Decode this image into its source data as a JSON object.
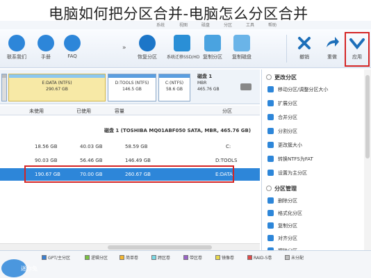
{
  "title": "电脑如何把分区合并-电脑怎么分区合并",
  "menubar": {
    "items": [
      "系统",
      "视图",
      "磁盘",
      "分区",
      "工具",
      "帮助"
    ]
  },
  "toolbar": {
    "items": [
      {
        "label": "恢复分区",
        "icon": "recover-icon",
        "color": "#1c76c8"
      },
      {
        "label": "系统迁移SSD/HD",
        "icon": "migrate-icon",
        "color": "#2a8fd6"
      },
      {
        "label": "复制分区",
        "icon": "copy-partition-icon",
        "color": "#4aa3e0"
      },
      {
        "label": "复制磁盘",
        "icon": "copy-disk-icon",
        "color": "#6ab4e8"
      },
      {
        "label": "撤销",
        "icon": "undo-icon",
        "color": "#1d6fb9"
      },
      {
        "label": "重做",
        "icon": "redo-icon",
        "color": "#1d6fb9"
      },
      {
        "label": "应用",
        "icon": "apply-icon",
        "color": "#1d6fb9"
      }
    ],
    "left_items": [
      {
        "label": "联系我们",
        "icon": "email-icon",
        "color": "#2d86d9"
      },
      {
        "label": "手册",
        "icon": "help-icon",
        "color": "#2d86d9"
      },
      {
        "label": "FAQ",
        "icon": "faq-icon",
        "color": "#2d86d9"
      }
    ],
    "more": "»"
  },
  "disk_map": {
    "partitions": [
      {
        "label": "未分配",
        "size": "",
        "selected": false
      },
      {
        "label": "E:DATA (NTFS)",
        "size": "290.67 GB",
        "selected": true
      },
      {
        "label": "D:TOOLS (NTFS)",
        "size": "146.5 GB",
        "selected": false
      },
      {
        "label": "C:(NTFS)",
        "size": "58.6 GB",
        "selected": false
      }
    ],
    "disk": {
      "name": "磁盘 1",
      "type": "MBR",
      "size": "465.76 GB"
    }
  },
  "table": {
    "headers": [
      "分区",
      "容量",
      "已使用",
      "未使用"
    ],
    "rows": [
      {
        "kind": "disk",
        "partition": "磁盘 1 (TOSHIBA MQ01ABF050 SATA, MBR, 465.76 GB)",
        "capacity": "",
        "used": "",
        "free": ""
      },
      {
        "kind": "part",
        "partition": "C:",
        "capacity": "58.59 GB",
        "used": "40.03 GB",
        "free": "18.56 GB"
      },
      {
        "kind": "part",
        "partition": "D:TOOLS",
        "capacity": "146.49 GB",
        "used": "56.46 GB",
        "free": "90.03 GB"
      },
      {
        "kind": "sel",
        "partition": "E:DATA",
        "capacity": "260.67 GB",
        "used": "70.00 GB",
        "free": "190.67 GB"
      }
    ]
  },
  "side": {
    "section1": "更改分区",
    "items1": [
      "移动分区/调整分区大小",
      "扩展分区",
      "合并分区",
      "分割分区",
      "更改簇大小",
      "转换NTFS为FAT",
      "设置为主分区"
    ],
    "section2": "分区管理",
    "items2": [
      "删除分区",
      "格式化分区",
      "复制分区",
      "对齐分区",
      "擦除分区"
    ]
  },
  "legend": {
    "logo_text": "迷你兔",
    "items": [
      {
        "label": "GPT/主分区",
        "color": "#3a7fd0"
      },
      {
        "label": "逻辑分区",
        "color": "#7ac142"
      },
      {
        "label": "简单卷",
        "color": "#f2b632"
      },
      {
        "label": "跨区卷",
        "color": "#7ad7e3"
      },
      {
        "label": "带区卷",
        "color": "#9a64c8"
      },
      {
        "label": "镜像卷",
        "color": "#e8d84a"
      },
      {
        "label": "RAID-5卷",
        "color": "#e04a4a"
      },
      {
        "label": "未分配",
        "color": "#bdbdbd"
      }
    ]
  }
}
